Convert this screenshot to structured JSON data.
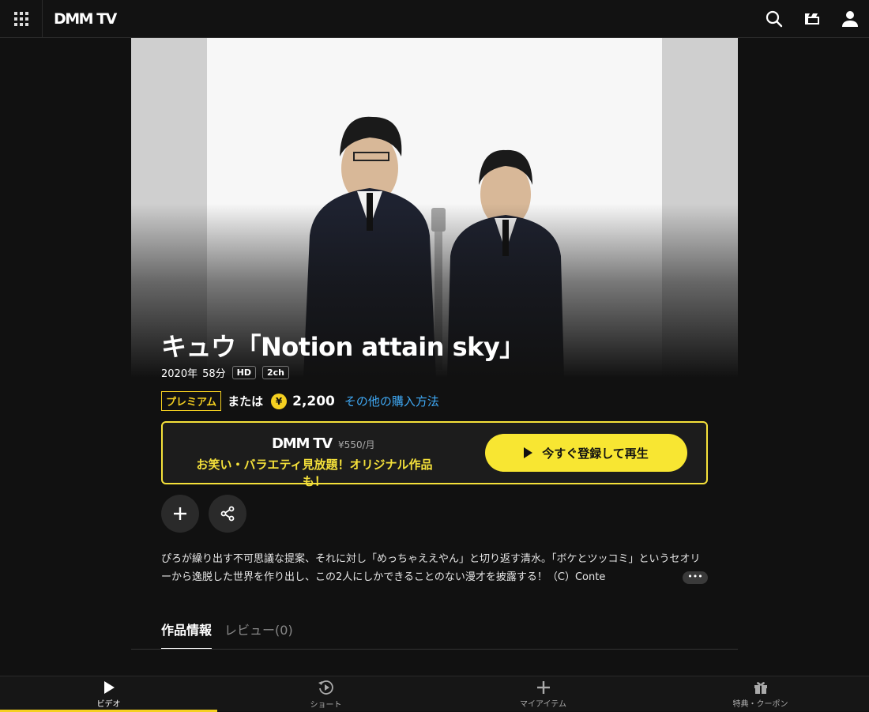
{
  "header": {
    "logo": "DMM TV",
    "icons": [
      "apps-grid-icon",
      "search-icon",
      "clapperboard-icon",
      "user-icon"
    ]
  },
  "content": {
    "title": "キュウ「Notion attain sky」",
    "year": "2020年",
    "duration": "58分",
    "badges": [
      "HD",
      "2ch"
    ],
    "premium_label": "プレミアム",
    "or_label": "または",
    "yen_symbol": "¥",
    "price": "2,200",
    "other_purchase": "その他の購入方法",
    "promo": {
      "logo": "DMM TV",
      "price": "¥550/月",
      "tagline": "お笑い・バラエティ見放題！オリジナル作品も！",
      "cta": "今すぐ登録して再生"
    },
    "description": "ぴろが繰り出す不可思議な提案、それに対し「めっちゃええやん」と切り返す清水。「ボケとツッコミ」というセオリーから逸脱した世界を作り出し、この2人にしかできることのない漫才を披露する！（C）Conte",
    "more_label": "•••",
    "tabs": [
      {
        "label": "作品情報",
        "active": true
      },
      {
        "label": "レビュー(0)",
        "active": false
      }
    ]
  },
  "bottom_nav": [
    {
      "label": "ビデオ",
      "icon": "play-icon",
      "active": true
    },
    {
      "label": "ショート",
      "icon": "short-play-icon",
      "active": false
    },
    {
      "label": "マイアイテム",
      "icon": "plus-icon",
      "active": false
    },
    {
      "label": "特典・クーポン",
      "icon": "gift-icon",
      "active": false
    }
  ],
  "colors": {
    "accent_yellow": "#f5d020",
    "link_blue": "#3fa9f5",
    "background": "#111111"
  }
}
